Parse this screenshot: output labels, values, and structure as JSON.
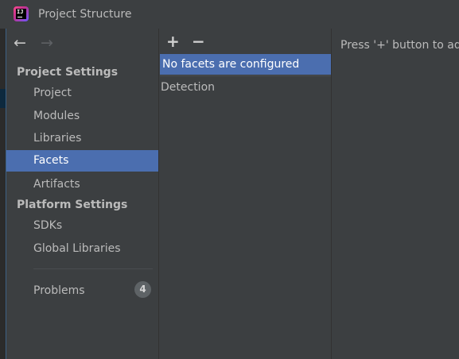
{
  "window": {
    "title": "Project Structure",
    "app_icon_text": "IJ"
  },
  "nav": {
    "back_icon": "←",
    "forward_icon": "→"
  },
  "sidebar": {
    "project_settings_header": "Project Settings",
    "project_settings_items": [
      {
        "label": "Project",
        "selected": false
      },
      {
        "label": "Modules",
        "selected": false
      },
      {
        "label": "Libraries",
        "selected": false
      },
      {
        "label": "Facets",
        "selected": true
      },
      {
        "label": "Artifacts",
        "selected": false
      }
    ],
    "platform_settings_header": "Platform Settings",
    "platform_settings_items": [
      {
        "label": "SDKs"
      },
      {
        "label": "Global Libraries"
      }
    ],
    "problems": {
      "label": "Problems",
      "count": "4"
    }
  },
  "facets_panel": {
    "add_icon": "+",
    "remove_icon": "−",
    "empty_message": "No facets are configured",
    "detection_label": "Detection"
  },
  "content": {
    "hint": "Press '+' button to ad"
  },
  "colors": {
    "background": "#3c3f41",
    "selection": "#4b6eaf",
    "text": "#bbbbbb"
  }
}
